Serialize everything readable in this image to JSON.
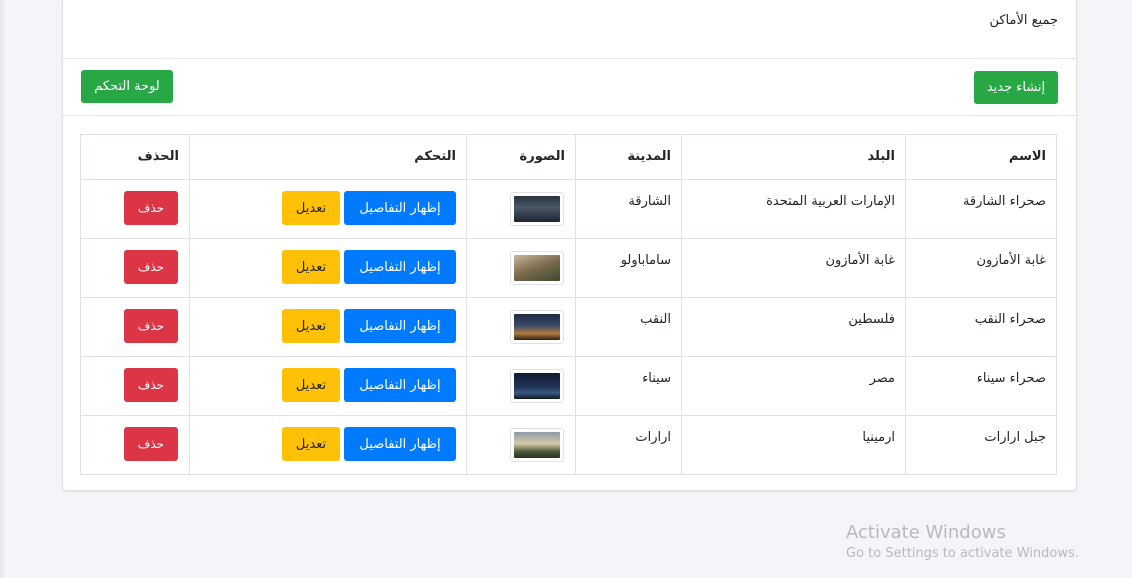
{
  "card": {
    "title": "جميع الأماكن"
  },
  "toolbar": {
    "create_label": "إنشاء جديد",
    "dashboard_label": "لوحة التحكم"
  },
  "table": {
    "headers": {
      "name": "الاسم",
      "country": "البلد",
      "city": "المدينة",
      "photo": "الصورة",
      "control": "التحكم",
      "delete": "الحذف"
    },
    "rows": [
      {
        "name": "صحراء الشارقة",
        "country": "الإمارات العربية المتحدة",
        "city": "الشارقة",
        "details_label": "إظهار التفاصيل",
        "edit_label": "تعديل",
        "delete_label": "حذف"
      },
      {
        "name": "غابة الأمازون",
        "country": "غابة الأمازون",
        "city": "ساماباولو",
        "details_label": "إظهار التفاصيل",
        "edit_label": "تعديل",
        "delete_label": "حذف"
      },
      {
        "name": "صحراء النقب",
        "country": "فلسطين",
        "city": "النقب",
        "details_label": "إظهار التفاصيل",
        "edit_label": "تعديل",
        "delete_label": "حذف"
      },
      {
        "name": "صحراء سيناء",
        "country": "مصر",
        "city": "سيناء",
        "details_label": "إظهار التفاصيل",
        "edit_label": "تعديل",
        "delete_label": "حذف"
      },
      {
        "name": "جبل ارارات",
        "country": "ارمينيا",
        "city": "ارارات",
        "details_label": "إظهار التفاصيل",
        "edit_label": "تعديل",
        "delete_label": "حذف"
      }
    ]
  },
  "watermark": {
    "title": "Activate Windows",
    "subtitle": "Go to Settings to activate Windows."
  },
  "colors": {
    "success": "#28a745",
    "primary": "#007bff",
    "warning": "#ffc107",
    "danger": "#dc3545"
  }
}
